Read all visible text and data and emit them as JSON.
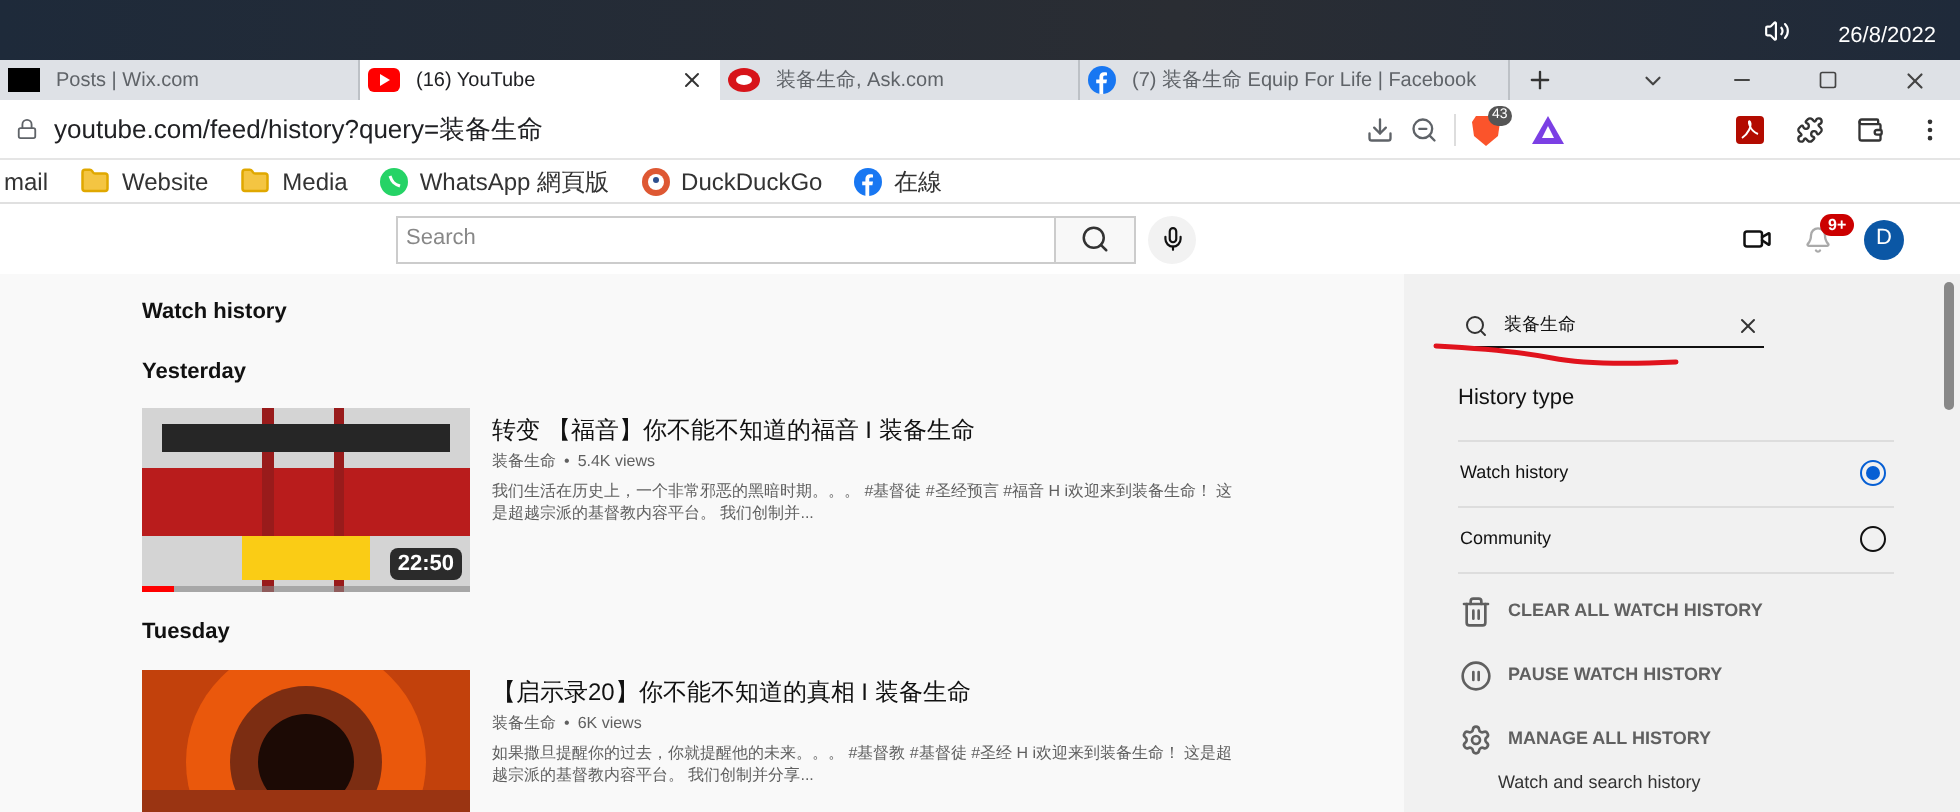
{
  "taskbar": {
    "date": "26/8/2022"
  },
  "tabs": [
    {
      "title": "Posts | Wix.com",
      "kind": "wix",
      "selected": false
    },
    {
      "title": "(16) YouTube",
      "kind": "youtube",
      "selected": true
    },
    {
      "title": "装备生命, Ask.com",
      "kind": "ask",
      "selected": false
    },
    {
      "title": "(7) 装备生命 Equip For Life | Facebook",
      "kind": "facebook",
      "selected": false
    }
  ],
  "address_bar": {
    "url": "youtube.com/feed/history?query=装备生命",
    "shields_count": "43"
  },
  "bookmarks": [
    {
      "label": "mail",
      "kind": "plain"
    },
    {
      "label": "Website",
      "kind": "folder"
    },
    {
      "label": "Media",
      "kind": "folder"
    },
    {
      "label": "WhatsApp 網頁版",
      "kind": "whatsapp"
    },
    {
      "label": "DuckDuckGo",
      "kind": "duck"
    },
    {
      "label": "在線",
      "kind": "facebook"
    }
  ],
  "header": {
    "search_placeholder": "Search",
    "notification_count": "9+",
    "avatar_letter": "D"
  },
  "page_title": "Watch history",
  "groups": [
    {
      "heading": "Yesterday",
      "videos": [
        {
          "title": "转变 【福音】你不能不知道的福音 I 装备生命",
          "channel": "装备生命",
          "separator": "•",
          "views": "5.4K views",
          "description": "我们生活在历史上，一个非常邪恶的黑暗时期。。。 #基督徒 #圣经预言 #福音 H i欢迎来到装备生命！ 这是超越宗派的基督教内容平台。 我们创制并...",
          "duration": "22:50",
          "level": 0.1
        }
      ]
    },
    {
      "heading": "Tuesday",
      "videos": [
        {
          "title": "【启示录20】你不能不知道的真相 I 装备生命",
          "channel": "装备生命",
          "separator": "•",
          "views": "6K views",
          "description": "如果撒旦提醒你的过去，你就提醒他的未来。。。 #基督教 #基督徒 #圣经 H i欢迎来到装备生命！ 这是超越宗派的基督教内容平台。 我们创制并分享..."
        }
      ]
    }
  ],
  "sidebar": {
    "search_value": "装备生命",
    "history_type_label": "History type",
    "history_types": [
      {
        "label": "Watch history",
        "selected": true
      },
      {
        "label": "Community",
        "selected": false
      }
    ],
    "actions": [
      {
        "label": "CLEAR ALL WATCH HISTORY",
        "kind": "trash"
      },
      {
        "label": "PAUSE WATCH HISTORY",
        "kind": "pause"
      },
      {
        "label": "MANAGE ALL HISTORY",
        "kind": "gear"
      }
    ],
    "links": [
      "Watch and search history"
    ]
  }
}
